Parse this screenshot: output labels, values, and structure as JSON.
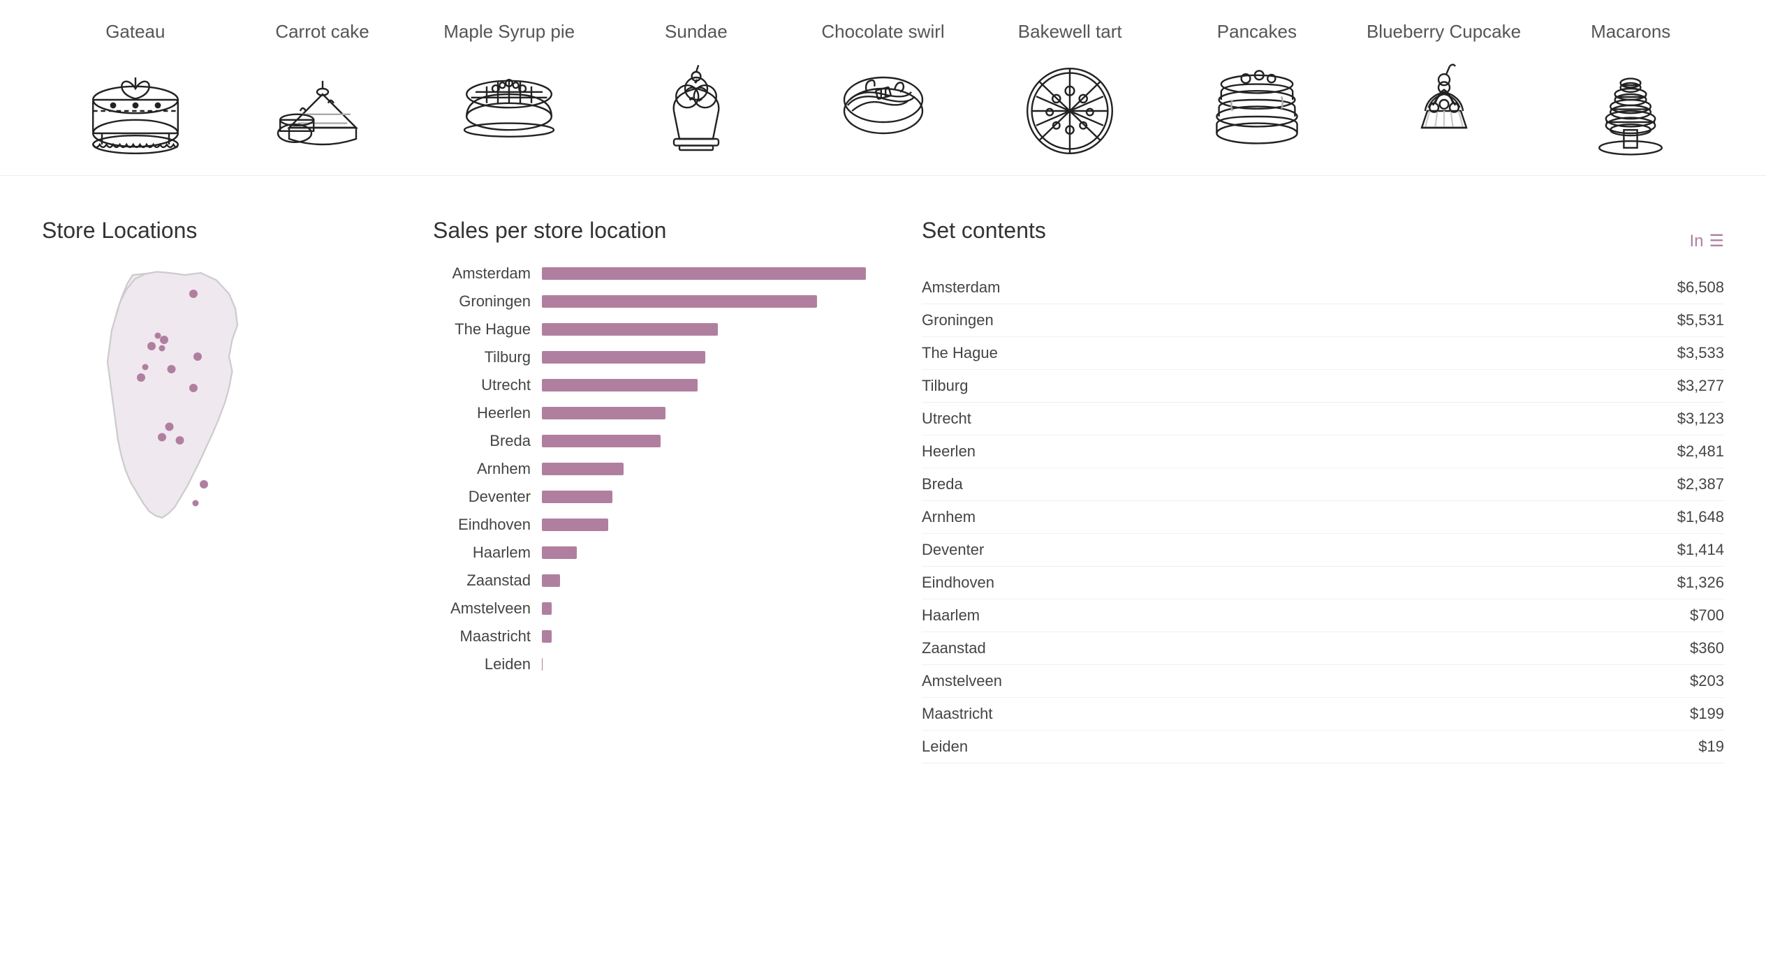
{
  "desserts": [
    {
      "id": "gateau",
      "label": "Gateau",
      "selected": true
    },
    {
      "id": "carrot-cake",
      "label": "Carrot cake",
      "selected": false
    },
    {
      "id": "maple-syrup-pie",
      "label": "Maple Syrup pie",
      "selected": false
    },
    {
      "id": "sundae",
      "label": "Sundae",
      "selected": false
    },
    {
      "id": "chocolate-swirl",
      "label": "Chocolate swirl",
      "selected": false
    },
    {
      "id": "bakewell-tart",
      "label": "Bakewell tart",
      "selected": false
    },
    {
      "id": "pancakes",
      "label": "Pancakes",
      "selected": false
    },
    {
      "id": "blueberry-cupcake",
      "label": "Blueberry Cupcake",
      "selected": false
    },
    {
      "id": "macarons",
      "label": "Macarons",
      "selected": false
    }
  ],
  "sections": {
    "store_locations": "Store Locations",
    "sales_title": "Sales per store location",
    "set_contents_title": "Set contents"
  },
  "sales": [
    {
      "city": "Amsterdam",
      "value": 6508,
      "pct": 100
    },
    {
      "city": "Groningen",
      "value": 5531,
      "pct": 85
    },
    {
      "city": "The Hague",
      "value": 3533,
      "pct": 54
    },
    {
      "city": "Tilburg",
      "value": 3277,
      "pct": 50
    },
    {
      "city": "Utrecht",
      "value": 3123,
      "pct": 48
    },
    {
      "city": "Heerlen",
      "value": 2481,
      "pct": 38
    },
    {
      "city": "Breda",
      "value": 2387,
      "pct": 37
    },
    {
      "city": "Arnhem",
      "value": 1648,
      "pct": 25
    },
    {
      "city": "Deventer",
      "value": 1414,
      "pct": 22
    },
    {
      "city": "Eindhoven",
      "value": 1326,
      "pct": 20
    },
    {
      "city": "Haarlem",
      "value": 700,
      "pct": 11
    },
    {
      "city": "Zaanstad",
      "value": 360,
      "pct": 6
    },
    {
      "city": "Amstelveen",
      "value": 203,
      "pct": 3
    },
    {
      "city": "Maastricht",
      "value": 199,
      "pct": 3
    },
    {
      "city": "Leiden",
      "value": 19,
      "pct": 1
    }
  ],
  "set_contents": [
    {
      "city": "Amsterdam",
      "value": "$6,508"
    },
    {
      "city": "Groningen",
      "value": "$5,531"
    },
    {
      "city": "The Hague",
      "value": "$3,533"
    },
    {
      "city": "Tilburg",
      "value": "$3,277"
    },
    {
      "city": "Utrecht",
      "value": "$3,123"
    },
    {
      "city": "Heerlen",
      "value": "$2,481"
    },
    {
      "city": "Breda",
      "value": "$2,387"
    },
    {
      "city": "Arnhem",
      "value": "$1,648"
    },
    {
      "city": "Deventer",
      "value": "$1,414"
    },
    {
      "city": "Eindhoven",
      "value": "$1,326"
    },
    {
      "city": "Haarlem",
      "value": "$700"
    },
    {
      "city": "Zaanstad",
      "value": "$360"
    },
    {
      "city": "Amstelveen",
      "value": "$203"
    },
    {
      "city": "Maastricht",
      "value": "$199"
    },
    {
      "city": "Leiden",
      "value": "$19"
    }
  ]
}
